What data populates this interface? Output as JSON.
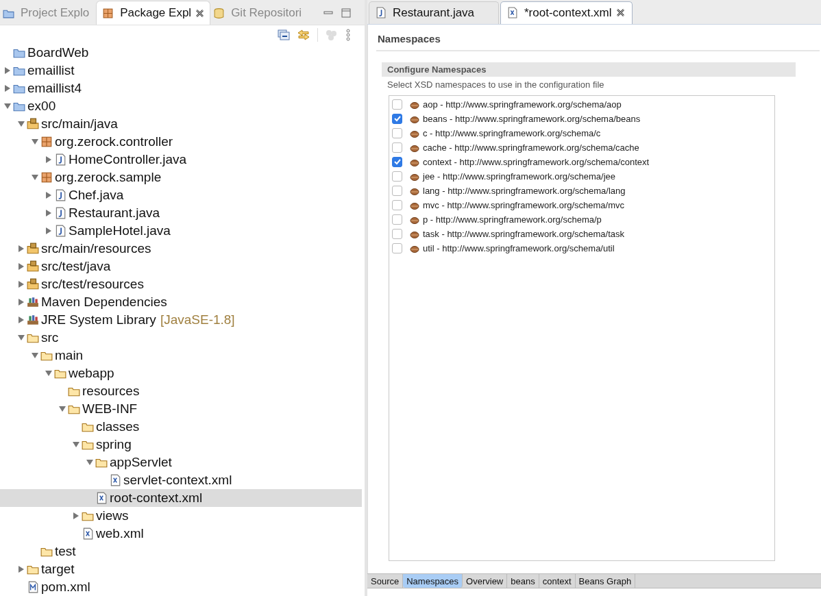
{
  "explorer": {
    "tabs": [
      {
        "label": "Project Explo",
        "kind": "project",
        "selected": false
      },
      {
        "label": "Package Expl",
        "kind": "package",
        "selected": true
      },
      {
        "label": "Git Repositori",
        "kind": "git",
        "selected": false
      }
    ],
    "tree": [
      {
        "label": "BoardWeb",
        "kind": "project",
        "selected": false
      },
      {
        "label": "emaillist",
        "kind": "project",
        "expanded": false,
        "selected": false
      },
      {
        "label": "emaillist4",
        "kind": "project",
        "expanded": false,
        "selected": false
      },
      {
        "label": "ex00",
        "kind": "project",
        "expanded": true,
        "selected": false,
        "children": [
          {
            "label": "src/main/java",
            "kind": "source-folder",
            "expanded": true,
            "selected": false,
            "children": [
              {
                "label": "org.zerock.controller",
                "kind": "package",
                "expanded": true,
                "selected": false,
                "children": [
                  {
                    "label": "HomeController.java",
                    "kind": "java",
                    "expanded": false,
                    "selected": false
                  }
                ]
              },
              {
                "label": "org.zerock.sample",
                "kind": "package",
                "expanded": true,
                "selected": false,
                "children": [
                  {
                    "label": "Chef.java",
                    "kind": "java",
                    "expanded": false,
                    "selected": false
                  },
                  {
                    "label": "Restaurant.java",
                    "kind": "java",
                    "expanded": false,
                    "selected": false
                  },
                  {
                    "label": "SampleHotel.java",
                    "kind": "java",
                    "expanded": false,
                    "selected": false
                  }
                ]
              }
            ]
          },
          {
            "label": "src/main/resources",
            "kind": "source-folder",
            "expanded": false,
            "selected": false
          },
          {
            "label": "src/test/java",
            "kind": "source-folder",
            "expanded": false,
            "selected": false
          },
          {
            "label": "src/test/resources",
            "kind": "source-folder",
            "expanded": false,
            "selected": false
          },
          {
            "label": "Maven Dependencies",
            "kind": "library",
            "expanded": false,
            "selected": false
          },
          {
            "label": "JRE System Library",
            "note": "[JavaSE-1.8]",
            "kind": "library",
            "expanded": false,
            "selected": false
          },
          {
            "label": "src",
            "kind": "folder",
            "expanded": true,
            "selected": false,
            "children": [
              {
                "label": "main",
                "kind": "folder",
                "expanded": true,
                "selected": false,
                "children": [
                  {
                    "label": "webapp",
                    "kind": "folder",
                    "expanded": true,
                    "selected": false,
                    "children": [
                      {
                        "label": "resources",
                        "kind": "folder",
                        "selected": false
                      },
                      {
                        "label": "WEB-INF",
                        "kind": "folder",
                        "expanded": true,
                        "selected": false,
                        "children": [
                          {
                            "label": "classes",
                            "kind": "folder",
                            "selected": false
                          },
                          {
                            "label": "spring",
                            "kind": "folder",
                            "expanded": true,
                            "selected": false,
                            "children": [
                              {
                                "label": "appServlet",
                                "kind": "folder",
                                "expanded": true,
                                "selected": false,
                                "children": [
                                  {
                                    "label": "servlet-context.xml",
                                    "kind": "xml",
                                    "selected": false
                                  }
                                ]
                              },
                              {
                                "label": "root-context.xml",
                                "kind": "xml",
                                "selected": true
                              }
                            ]
                          },
                          {
                            "label": "views",
                            "kind": "folder",
                            "expanded": false,
                            "selected": false
                          },
                          {
                            "label": "web.xml",
                            "kind": "xml",
                            "selected": false
                          }
                        ]
                      }
                    ]
                  }
                ]
              },
              {
                "label": "test",
                "kind": "folder",
                "selected": false
              }
            ]
          },
          {
            "label": "target",
            "kind": "folder",
            "expanded": false,
            "selected": false
          },
          {
            "label": "pom.xml",
            "kind": "maven",
            "selected": false
          }
        ]
      }
    ]
  },
  "editor": {
    "tabs": [
      {
        "label": "Restaurant.java",
        "kind": "java",
        "selected": false
      },
      {
        "label": "*root-context.xml",
        "kind": "xml",
        "selected": true
      }
    ],
    "page_title": "Namespaces",
    "section": {
      "title": "Configure Namespaces",
      "description": "Select XSD namespaces to use in the configuration file",
      "namespaces": [
        {
          "label": "aop - http://www.springframework.org/schema/aop",
          "checked": false
        },
        {
          "label": "beans - http://www.springframework.org/schema/beans",
          "checked": true
        },
        {
          "label": "c - http://www.springframework.org/schema/c",
          "checked": false
        },
        {
          "label": "cache - http://www.springframework.org/schema/cache",
          "checked": false
        },
        {
          "label": "context - http://www.springframework.org/schema/context",
          "checked": true
        },
        {
          "label": "jee - http://www.springframework.org/schema/jee",
          "checked": false
        },
        {
          "label": "lang - http://www.springframework.org/schema/lang",
          "checked": false
        },
        {
          "label": "mvc - http://www.springframework.org/schema/mvc",
          "checked": false
        },
        {
          "label": "p - http://www.springframework.org/schema/p",
          "checked": false
        },
        {
          "label": "task - http://www.springframework.org/schema/task",
          "checked": false
        },
        {
          "label": "util - http://www.springframework.org/schema/util",
          "checked": false
        }
      ]
    },
    "bottom_tabs": [
      {
        "label": "Source",
        "selected": false
      },
      {
        "label": "Namespaces",
        "selected": true
      },
      {
        "label": "Overview",
        "selected": false
      },
      {
        "label": "beans",
        "selected": false
      },
      {
        "label": "context",
        "selected": false
      },
      {
        "label": "Beans Graph",
        "selected": false
      }
    ]
  }
}
